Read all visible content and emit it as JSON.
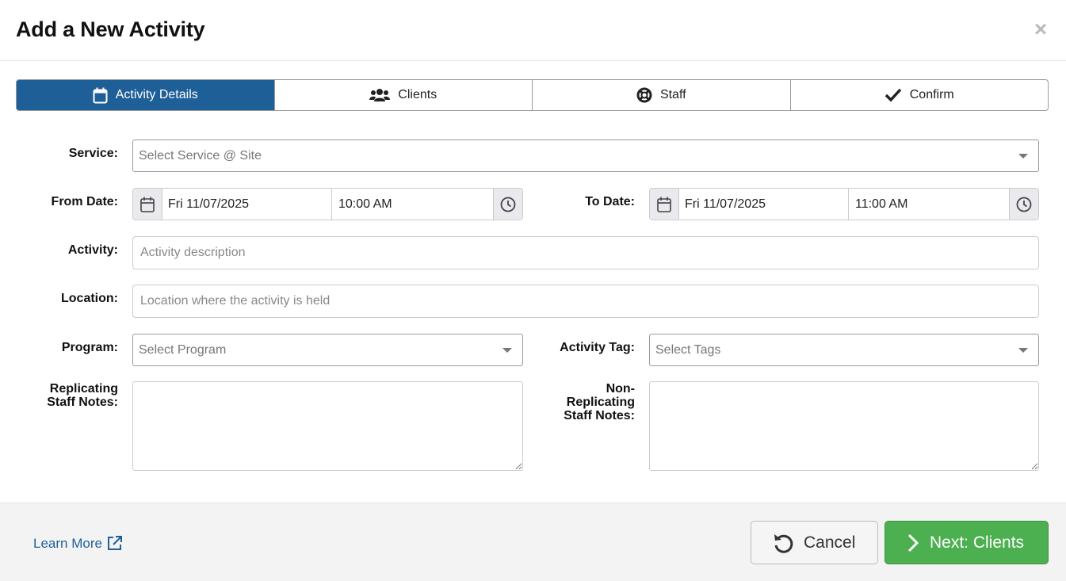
{
  "dialog": {
    "title": "Add a New Activity",
    "close_label": "×"
  },
  "tabs": [
    {
      "label": "Activity Details",
      "icon": "calendar-icon",
      "active": true
    },
    {
      "label": "Clients",
      "icon": "users-icon",
      "active": false
    },
    {
      "label": "Staff",
      "icon": "life-ring-icon",
      "active": false
    },
    {
      "label": "Confirm",
      "icon": "check-icon",
      "active": false
    }
  ],
  "form": {
    "service": {
      "label": "Service:",
      "placeholder": "Select Service @ Site"
    },
    "from_date": {
      "label": "From Date:",
      "date": "Fri 11/07/2025",
      "time": "10:00 AM"
    },
    "to_date": {
      "label": "To Date:",
      "date": "Fri 11/07/2025",
      "time": "11:00 AM"
    },
    "activity": {
      "label": "Activity:",
      "placeholder": "Activity description",
      "value": ""
    },
    "location": {
      "label": "Location:",
      "placeholder": "Location where the activity is held",
      "value": ""
    },
    "program": {
      "label": "Program:",
      "placeholder": "Select Program"
    },
    "activity_tag": {
      "label": "Activity Tag:",
      "placeholder": "Select Tags"
    },
    "replicating_notes": {
      "label_line1": "Replicating",
      "label_line2": "Staff Notes:",
      "value": ""
    },
    "non_replicating_notes": {
      "label_line1": "Non-",
      "label_line2": "Replicating",
      "label_line3": "Staff Notes:",
      "value": ""
    }
  },
  "footer": {
    "learn_more": "Learn More",
    "cancel_label": "Cancel",
    "next_label": "Next: Clients"
  },
  "colors": {
    "primary": "#1f5f98",
    "success": "#4caf50",
    "link": "#1f5f98"
  }
}
